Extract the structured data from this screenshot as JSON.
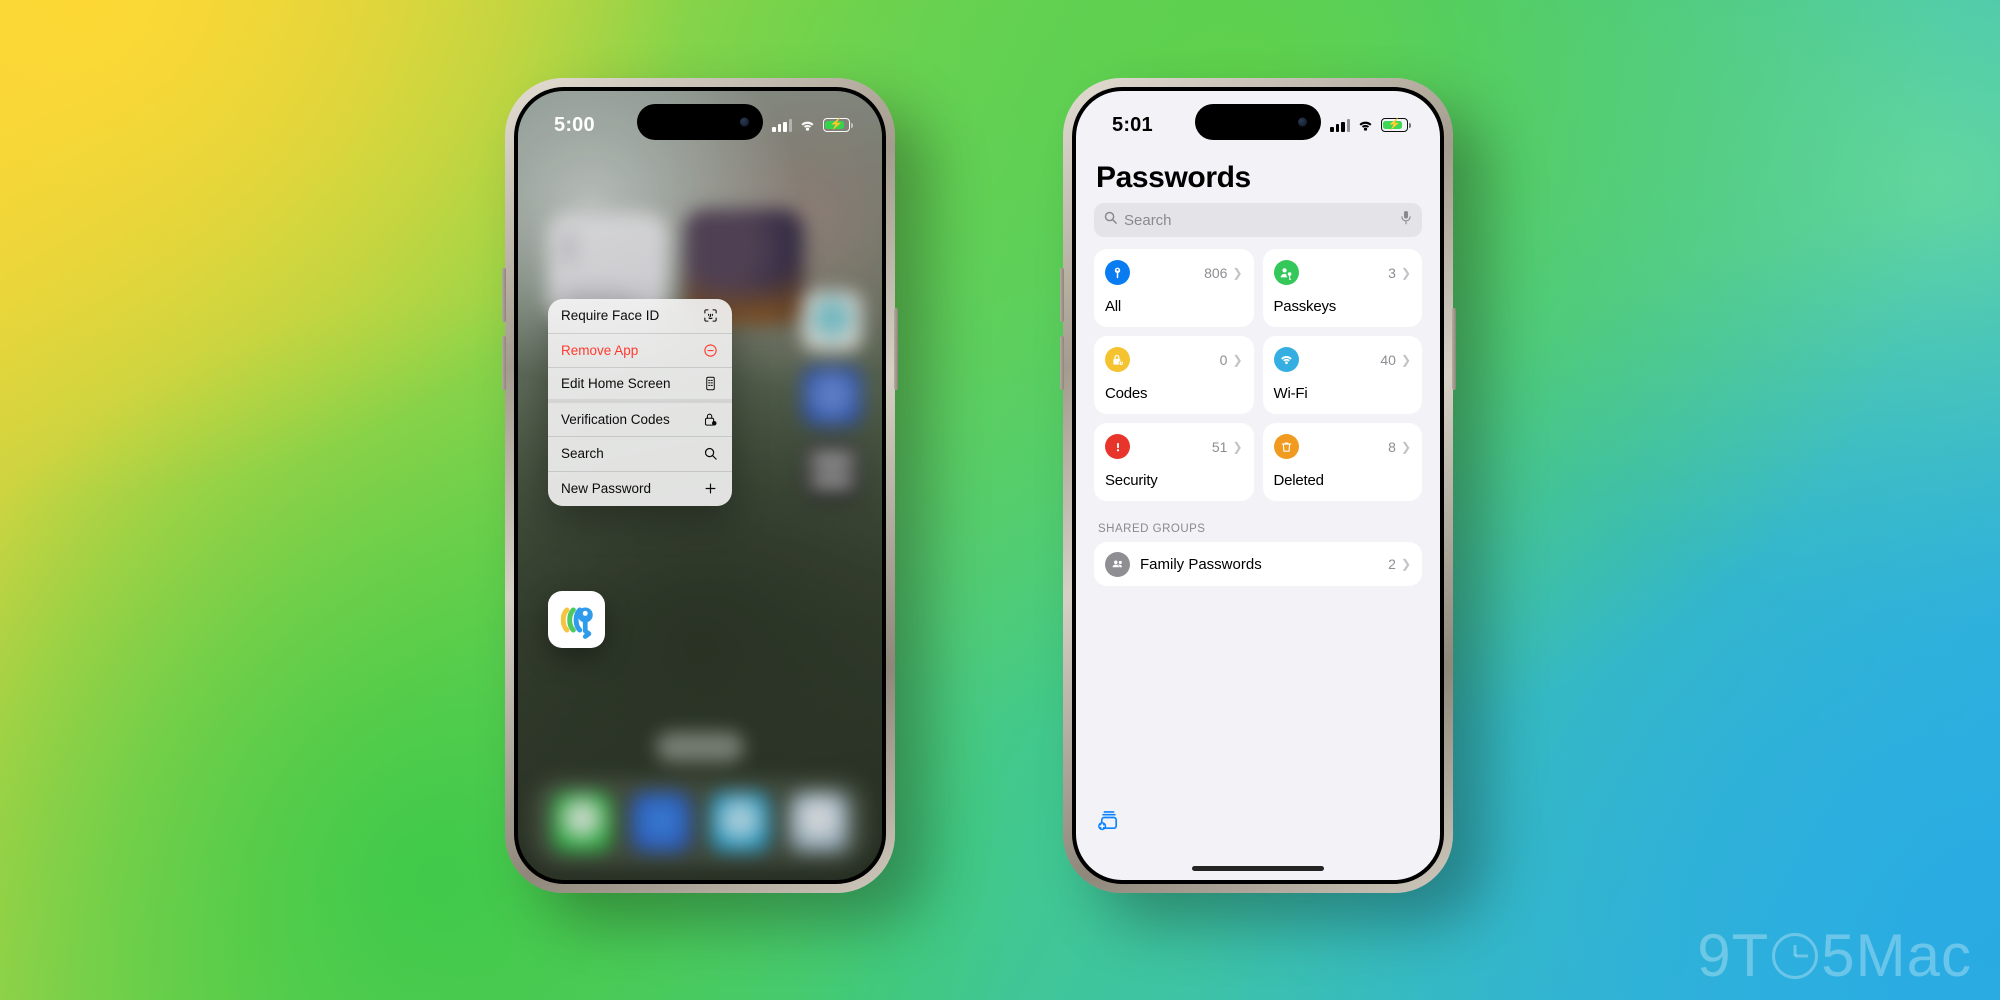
{
  "background": {
    "colors": [
      "#FDD835",
      "#5FD14A",
      "#3FC94A",
      "#29ABE2",
      "#62D6A0"
    ]
  },
  "watermark": {
    "prefix": "9T",
    "suffix": "5Mac"
  },
  "left_phone": {
    "status": {
      "time": "5:00",
      "cellular": "signal-bars",
      "wifi": "wifi",
      "battery": "battery-charging"
    },
    "context_menu": {
      "items": [
        {
          "label": "Require Face ID",
          "icon": "face-id-icon",
          "destructive": false
        },
        {
          "label": "Remove App",
          "icon": "minus-circle-icon",
          "destructive": true
        },
        {
          "label": "Edit Home Screen",
          "icon": "edit-home-icon",
          "destructive": false
        },
        {
          "label": "Verification Codes",
          "icon": "lock-clock-icon",
          "destructive": false
        },
        {
          "label": "Search",
          "icon": "search-icon",
          "destructive": false
        },
        {
          "label": "New Password",
          "icon": "plus-icon",
          "destructive": false
        }
      ]
    },
    "app_icon": {
      "name": "passwords-app-icon",
      "colors": [
        "#F5C542",
        "#4CC85E",
        "#2F9BEA"
      ]
    }
  },
  "right_phone": {
    "status": {
      "time": "5:01",
      "cellular": "signal-bars",
      "wifi": "wifi",
      "battery": "battery-charging"
    },
    "title": "Passwords",
    "search": {
      "placeholder": "Search",
      "icon": "search-icon",
      "mic_icon": "microphone-icon"
    },
    "cards": [
      {
        "label": "All",
        "count": "806",
        "icon": "key-icon",
        "color": "#0A7CF1"
      },
      {
        "label": "Passkeys",
        "count": "3",
        "icon": "passkey-person-icon",
        "color": "#34C759"
      },
      {
        "label": "Codes",
        "count": "0",
        "icon": "lock-clock-icon",
        "color": "#F5C330"
      },
      {
        "label": "Wi-Fi",
        "count": "40",
        "icon": "wifi-icon",
        "color": "#35AEE2"
      },
      {
        "label": "Security",
        "count": "51",
        "icon": "exclamation-icon",
        "color": "#E8352B"
      },
      {
        "label": "Deleted",
        "count": "8",
        "icon": "trash-icon",
        "color": "#F09A20"
      }
    ],
    "shared_groups": {
      "header": "SHARED GROUPS",
      "rows": [
        {
          "name": "Family Passwords",
          "count": "2",
          "icon": "people-group-icon"
        }
      ]
    },
    "bottom_action": {
      "icon": "new-shared-group-icon",
      "color": "#0A84FF"
    }
  }
}
